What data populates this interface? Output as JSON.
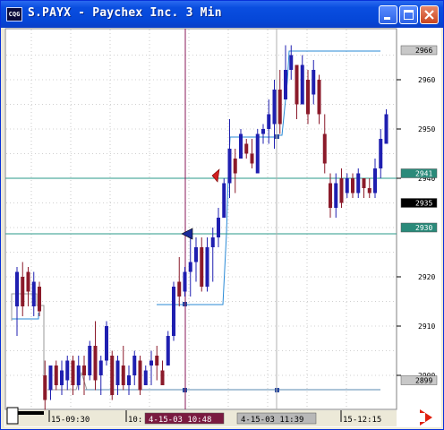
{
  "window": {
    "title": "S.PAYX - Paychex Inc. 3 Min",
    "icon_text": "CQG"
  },
  "price_axis": {
    "labels": [
      "2960",
      "2950",
      "2940",
      "2920",
      "2910",
      "2900"
    ],
    "highlight_labels": [
      {
        "text": "2966",
        "style": "gray"
      },
      {
        "text": "2941",
        "style": "teal"
      },
      {
        "text": "2935",
        "style": "black"
      },
      {
        "text": "2930",
        "style": "teal"
      },
      {
        "text": "2899",
        "style": "gray"
      }
    ]
  },
  "time_axis": {
    "labels": [
      "15-09:30",
      "10:",
      "15-12:15"
    ],
    "cursor_labels": [
      {
        "text": "4-15-03 10:48",
        "style": "maroon"
      },
      {
        "text": "4-15-03 11:39",
        "style": "gray"
      }
    ]
  },
  "colors": {
    "up_bar": "#1f1fb0",
    "down_bar": "#8b1a2a",
    "study_line": "#2a8ad6",
    "level_line": "#2a9a8a",
    "cursor_line": "#8a1a5a",
    "accent": "#0a4ee0"
  },
  "chart_data": {
    "type": "candlestick",
    "symbol": "S.PAYX",
    "ylim": [
      2897,
      2969
    ],
    "cursors": [
      "10:48",
      "11:39"
    ],
    "horizontal_levels": [
      2941,
      2930,
      2899
    ],
    "series": [
      {
        "values": [
          [
            2922,
            2908,
            2914,
            2921
          ],
          [
            2923,
            2912,
            2920,
            2914
          ],
          [
            2922,
            2914,
            2921,
            2917
          ],
          [
            2921,
            2912,
            2914,
            2919
          ],
          [
            2919,
            2912,
            2918,
            2913
          ],
          [
            2903,
            2893,
            2900,
            2895
          ],
          [
            2902,
            2895,
            2897,
            2902
          ],
          [
            2903,
            2897,
            2902,
            2898
          ],
          [
            2903,
            2896,
            2898,
            2901
          ],
          [
            2904,
            2897,
            2899,
            2903
          ],
          [
            2904,
            2896,
            2903,
            2898
          ],
          [
            2904,
            2897,
            2898,
            2902
          ],
          [
            2904,
            2896,
            2902,
            2900
          ],
          [
            2907,
            2899,
            2900,
            2906
          ],
          [
            2911,
            2897,
            2906,
            2899
          ],
          [
            2904,
            2896,
            2900,
            2903
          ],
          [
            2911,
            2902,
            2903,
            2910
          ],
          [
            2905,
            2895,
            2904,
            2896
          ],
          [
            2904,
            2896,
            2898,
            2903
          ],
          [
            2906,
            2897,
            2902,
            2898
          ],
          [
            2902,
            2896,
            2898,
            2900
          ],
          [
            2905,
            2898,
            2900,
            2904
          ],
          [
            2904,
            2896,
            2903,
            2897
          ],
          [
            2902,
            2898,
            2898,
            2901
          ],
          [
            2905,
            2898,
            2902,
            2903
          ],
          [
            2906,
            2899,
            2904,
            2902
          ],
          [
            2903,
            2898,
            2901,
            2898
          ],
          [
            2909,
            2902,
            2902,
            2908
          ],
          [
            2919,
            2907,
            2908,
            2918
          ],
          [
            2924,
            2914,
            2919,
            2916
          ],
          [
            2922,
            2916,
            2917,
            2921
          ],
          [
            2929,
            2916,
            2921,
            2923
          ],
          [
            2928,
            2919,
            2923,
            2926
          ],
          [
            2928,
            2917,
            2926,
            2918
          ],
          [
            2928,
            2917,
            2918,
            2926
          ],
          [
            2930,
            2919,
            2926,
            2928
          ],
          [
            2934,
            2926,
            2928,
            2932
          ],
          [
            2940,
            2932,
            2932,
            2939
          ],
          [
            2952,
            2936,
            2939,
            2946
          ],
          [
            2946,
            2937,
            2944,
            2941
          ],
          [
            2950,
            2944,
            2944,
            2949
          ],
          [
            2948,
            2944,
            2947,
            2945
          ],
          [
            2948,
            2942,
            2945,
            2943
          ],
          [
            2950,
            2941,
            2941,
            2949
          ],
          [
            2951,
            2947,
            2949,
            2950
          ],
          [
            2956,
            2947,
            2950,
            2953
          ],
          [
            2960,
            2946,
            2951,
            2958
          ],
          [
            2962,
            2949,
            2958,
            2951
          ],
          [
            2967,
            2956,
            2956,
            2962
          ],
          [
            2967,
            2960,
            2962,
            2965
          ],
          [
            2963,
            2952,
            2963,
            2955
          ],
          [
            2965,
            2955,
            2955,
            2963
          ],
          [
            2962,
            2951,
            2960,
            2953
          ],
          [
            2964,
            2955,
            2957,
            2962
          ],
          [
            2961,
            2951,
            2960,
            2953
          ],
          [
            2953,
            2941,
            2949,
            2943
          ],
          [
            2941,
            2932,
            2939,
            2934
          ],
          [
            2941,
            2932,
            2934,
            2939
          ],
          [
            2942,
            2934,
            2940,
            2935
          ],
          [
            2941,
            2936,
            2937,
            2940
          ],
          [
            2941,
            2936,
            2940,
            2937
          ],
          [
            2942,
            2936,
            2937,
            2941
          ],
          [
            2940,
            2936,
            2940,
            2938
          ],
          [
            2940,
            2936,
            2938,
            2937
          ],
          [
            2944,
            2936,
            2937,
            2942
          ],
          [
            2950,
            2940,
            2942,
            2948
          ],
          [
            2954,
            2947,
            2947,
            2953
          ]
        ]
      }
    ]
  }
}
